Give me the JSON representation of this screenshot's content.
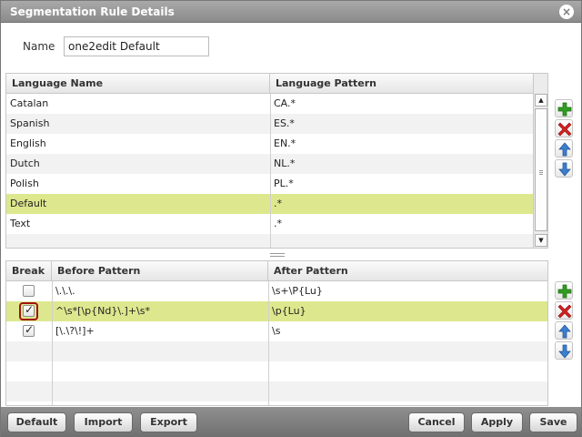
{
  "window": {
    "title": "Segmentation Rule Details",
    "close_glyph": "×"
  },
  "name_field": {
    "label": "Name",
    "value": "one2edit Default"
  },
  "languages": {
    "headers": [
      "Language Name",
      "Language Pattern"
    ],
    "rows": [
      {
        "name": "Catalan",
        "pattern": "CA.*"
      },
      {
        "name": "Spanish",
        "pattern": "ES.*"
      },
      {
        "name": "English",
        "pattern": "EN.*"
      },
      {
        "name": "Dutch",
        "pattern": "NL.*"
      },
      {
        "name": "Polish",
        "pattern": "PL.*"
      },
      {
        "name": "Default",
        "pattern": ".*",
        "selected": true
      },
      {
        "name": "Text",
        "pattern": ".*"
      }
    ]
  },
  "rules": {
    "headers": [
      "Break",
      "Before Pattern",
      "After Pattern"
    ],
    "rows": [
      {
        "break": false,
        "before": "\\.\\.\\.",
        "after": "\\s+\\P{Lu}"
      },
      {
        "break": true,
        "before": "^\\s*[\\p{Nd}\\.]+\\s*",
        "after": "\\p{Lu}",
        "selected": true,
        "highlighted": true
      },
      {
        "break": true,
        "before": "[\\.\\?\\!]+",
        "after": "\\s"
      }
    ]
  },
  "side_buttons": [
    "add-icon",
    "delete-icon",
    "move-up-icon",
    "move-down-icon"
  ],
  "footer": {
    "left": [
      "Default",
      "Import",
      "Export"
    ],
    "right": [
      "Cancel",
      "Apply",
      "Save"
    ]
  },
  "colors": {
    "selection": "#dde88e",
    "highlight_border": "#a31212",
    "add": "#2e9e1f",
    "delete": "#d42020",
    "arrow": "#3a7fd0"
  }
}
